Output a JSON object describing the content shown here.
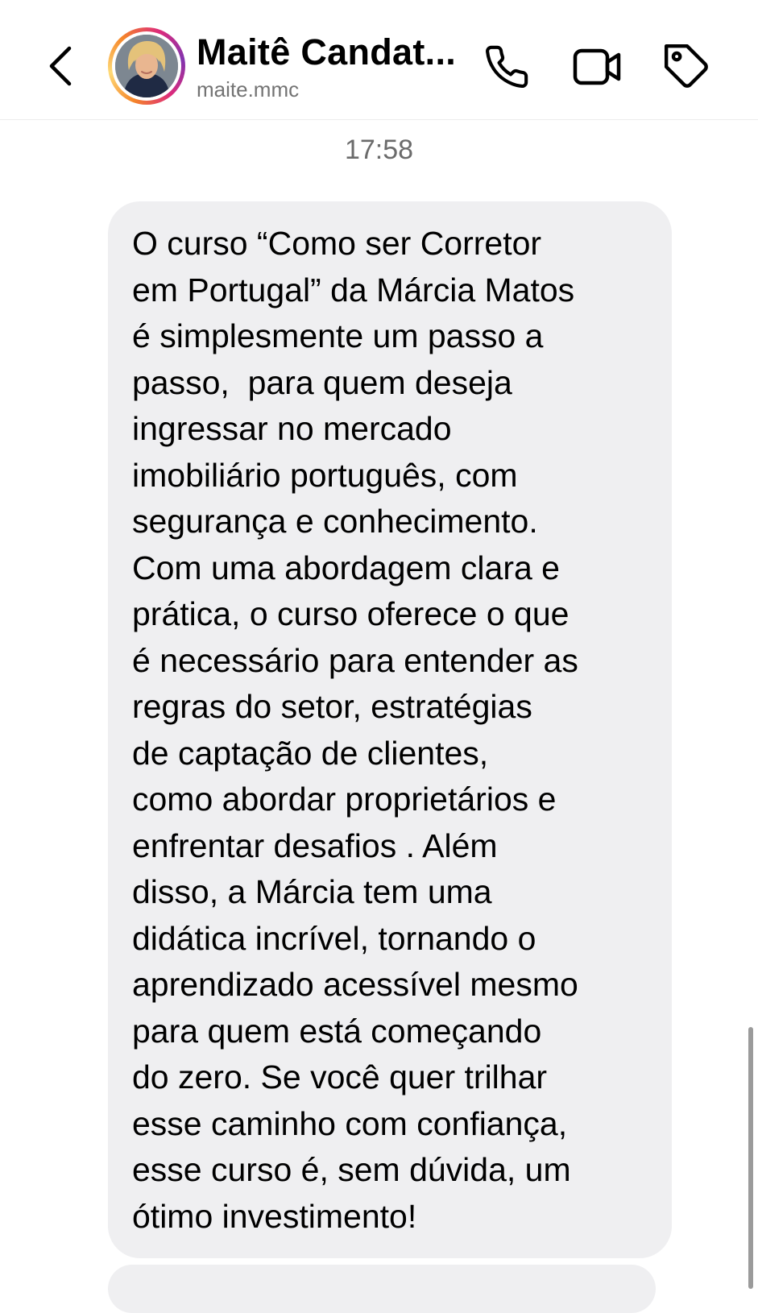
{
  "header": {
    "contact_name": "Maitê Candat...",
    "username": "maite.mmc",
    "icons": {
      "back": "chevron-left-icon",
      "call": "phone-icon",
      "video": "video-camera-icon",
      "tag": "tag-icon"
    }
  },
  "thread": {
    "timestamp": "17:58",
    "message_lines": [
      "O curso “Como ser Corretor",
      "em Portugal” da Márcia Matos",
      "é simplesmente um passo a",
      "passo,  para quem deseja",
      "ingressar no mercado",
      "imobiliário português, com",
      "segurança e conhecimento.",
      "Com uma abordagem clara e",
      "prática, o curso oferece o que",
      "é necessário para entender as",
      "regras do setor, estratégias",
      "de captação de clientes,",
      "como abordar proprietários e",
      "enfrentar desafios . Além",
      "disso, a Márcia tem uma",
      "didática incrível, tornando o",
      "aprendizado acessível mesmo",
      "para quem está começando",
      "do zero. Se você quer trilhar",
      "esse caminho com confiança,",
      "esse curso é, sem dúvida, um",
      "ótimo investimento!"
    ]
  },
  "colors": {
    "bubble_background": "#efeff1",
    "secondary_text": "#737373",
    "avatar_ring_gradient": [
      "#f58529",
      "#feda77",
      "#dd2a7b",
      "#8134af"
    ]
  }
}
